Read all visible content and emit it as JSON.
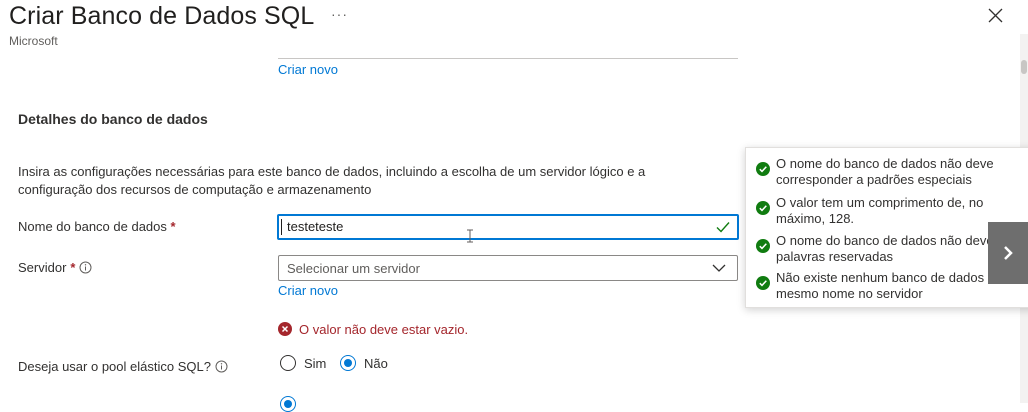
{
  "header": {
    "title": "Criar Banco de Dados SQL",
    "more_label": "···",
    "subtitle": "Microsoft"
  },
  "links": {
    "create_new_top": "Criar novo",
    "create_new_server": "Criar novo"
  },
  "section": {
    "title": "Detalhes do banco de dados",
    "description": "Insira as configurações necessárias para este banco de dados, incluindo a escolha de um servidor lógico e a configuração dos recursos de computação e armazenamento"
  },
  "fields": {
    "db_name": {
      "label": "Nome do banco de dados",
      "required": "*",
      "value": "testeteste"
    },
    "server": {
      "label": "Servidor",
      "required": "*",
      "placeholder": "Selecionar um servidor",
      "error": "O valor não deve estar vazio."
    },
    "elastic_pool": {
      "label": "Deseja usar o pool elástico SQL?",
      "options": [
        {
          "label": "Sim",
          "checked": false
        },
        {
          "label": "Não",
          "checked": true
        }
      ]
    }
  },
  "validation_tooltip": {
    "items": [
      "O nome do banco de dados não deve corresponder a padrões especiais",
      "O valor tem um comprimento de, no máximo, 128.",
      "O nome do banco de dados não deve conter palavras reservadas",
      "Não existe nenhum banco de dados com o mesmo nome no servidor"
    ]
  },
  "colors": {
    "accent": "#0078d4",
    "success": "#107c10",
    "error": "#a4262c"
  },
  "icons": {
    "close": "close-icon",
    "info": "info-icon",
    "check": "check-icon",
    "chevron_down": "chevron-down-icon",
    "error": "error-icon",
    "next": "chevron-right-icon"
  }
}
